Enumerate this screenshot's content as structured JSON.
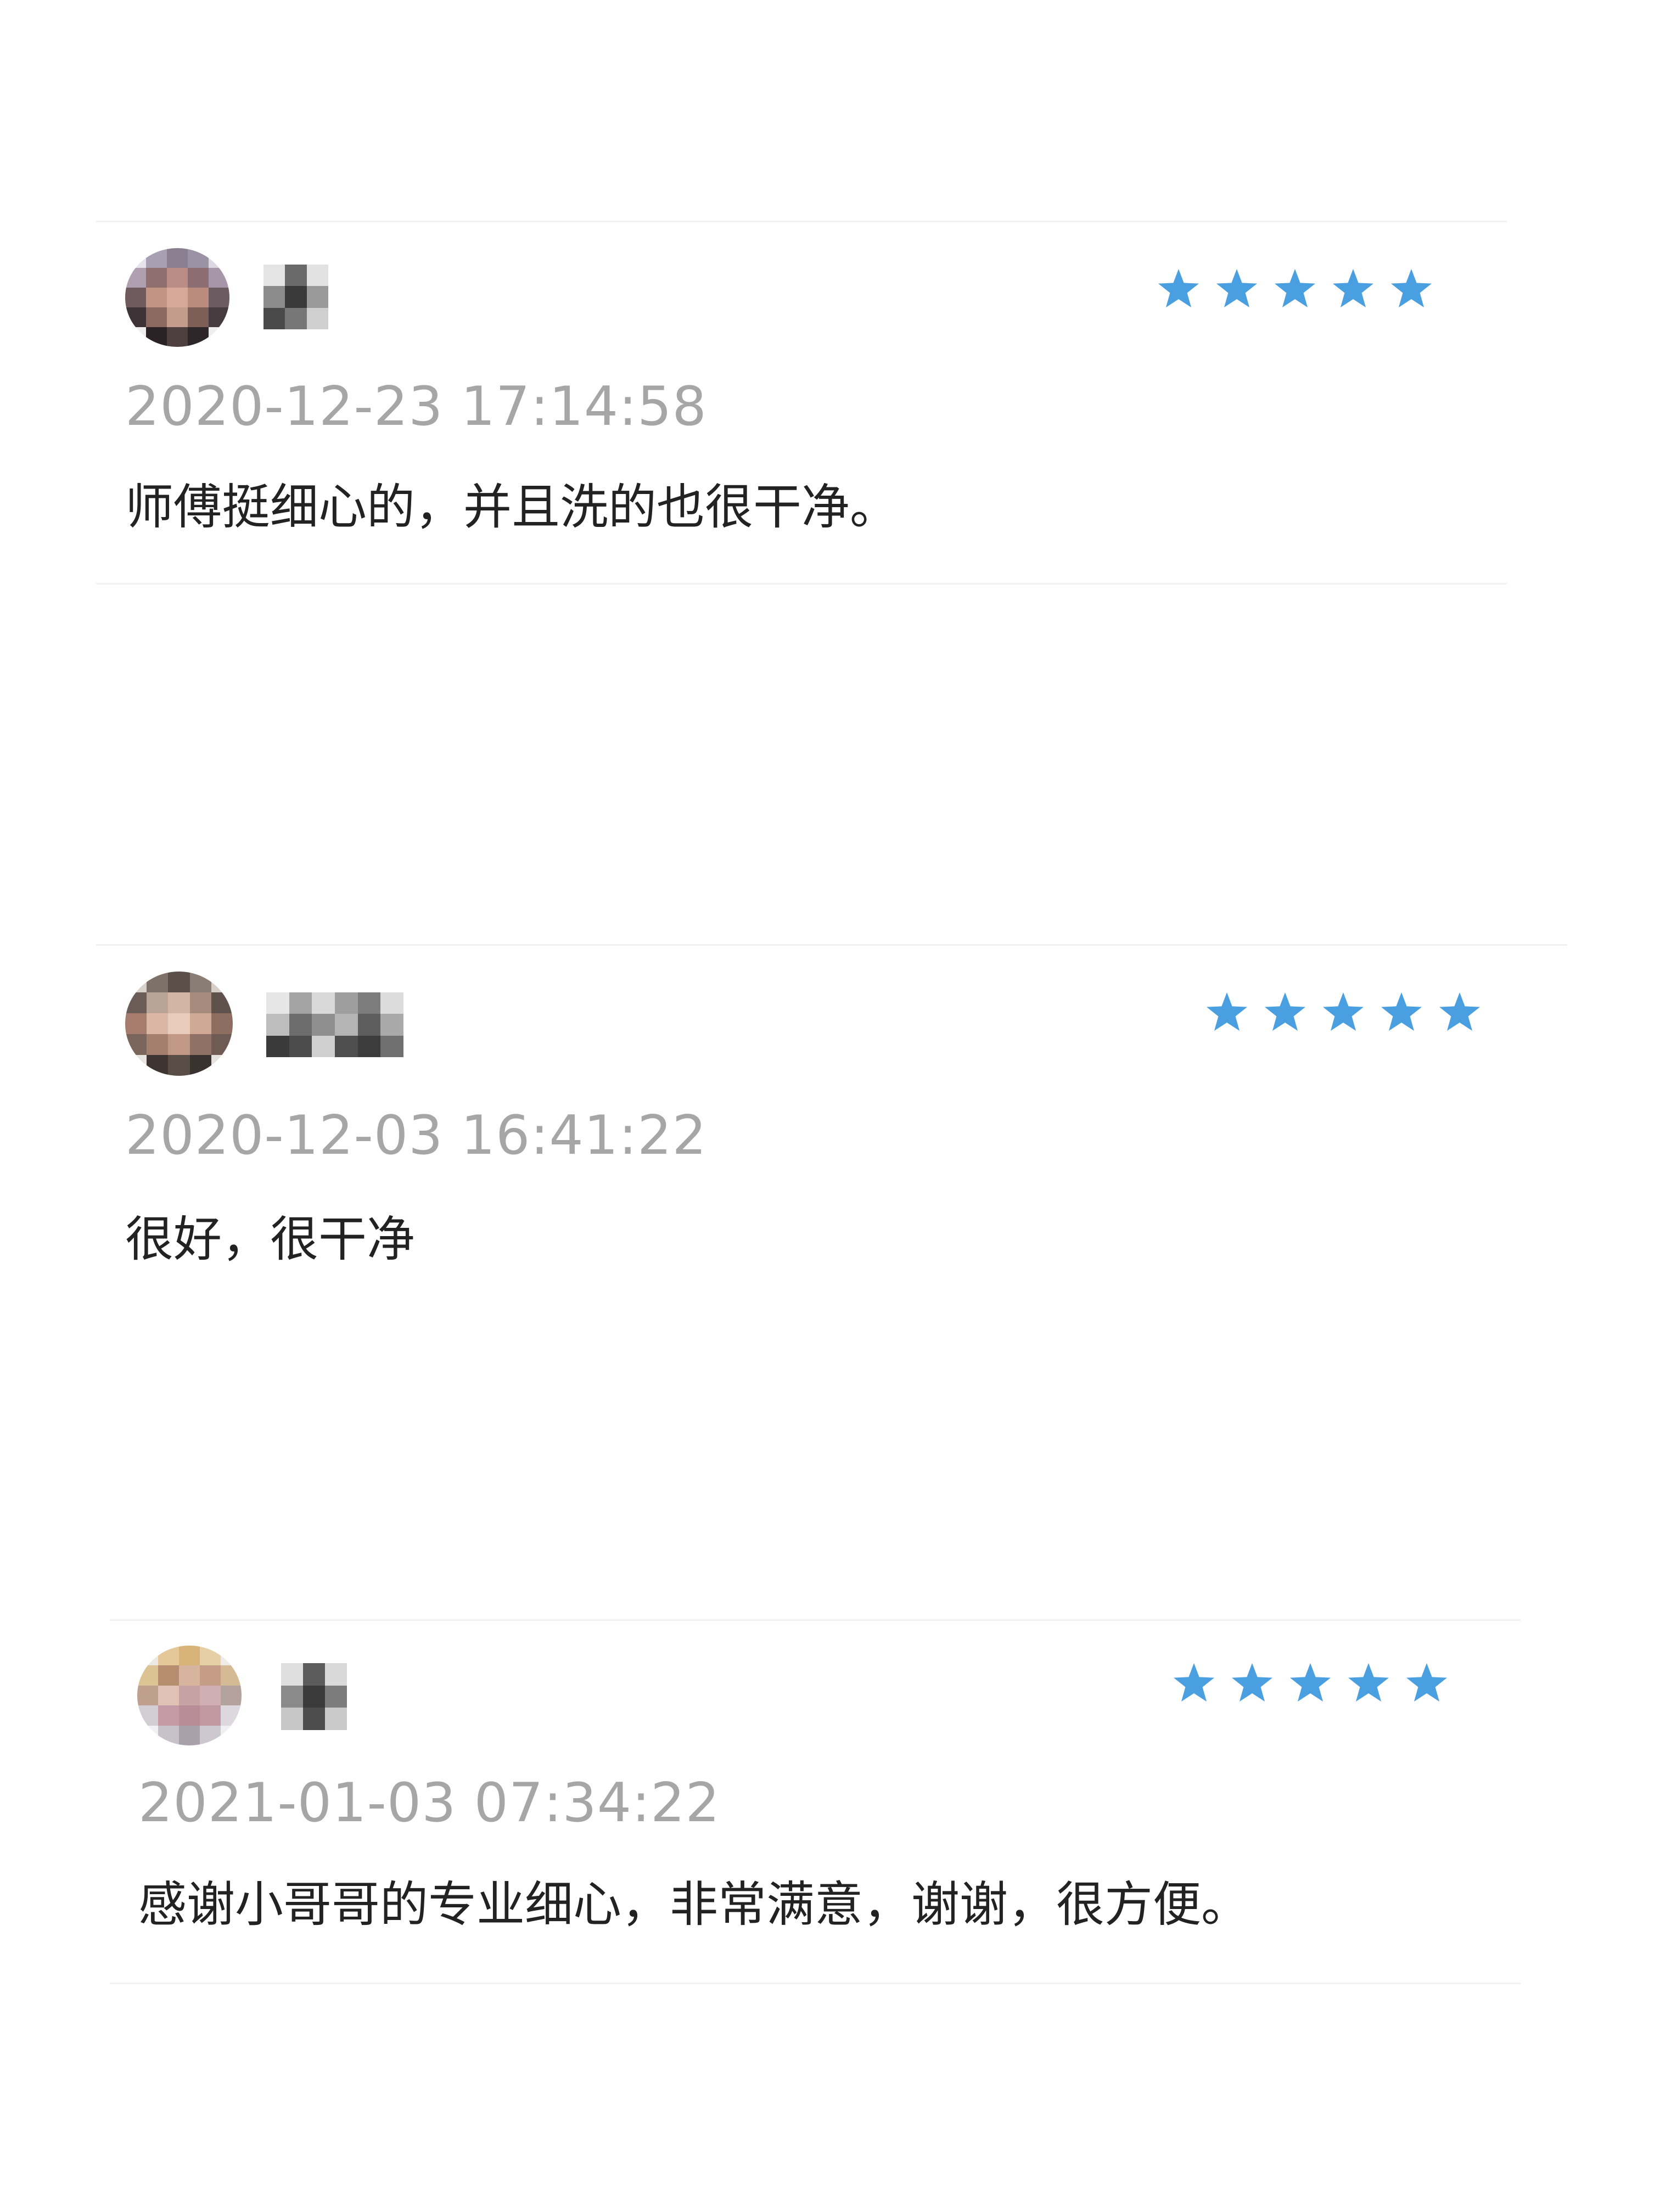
{
  "accent_color": "#4a9fe0",
  "star_icon": "star-icon",
  "reviews": [
    {
      "avatar_icon": "user-avatar",
      "name": "史",
      "rating": 5,
      "date": "2020-12-23 17:14:58",
      "comment": "师傅挺细心的，并且洗的也很干净。"
    },
    {
      "avatar_icon": "user-avatar",
      "name": "黑豆",
      "rating": 5,
      "date": "2020-12-03 16:41:22",
      "comment": "很好，很干净"
    },
    {
      "avatar_icon": "user-avatar",
      "name": "苗",
      "rating": 5,
      "date": "2021-01-03 07:34:22",
      "comment": "感谢小哥哥的专业细心，非常满意，谢谢，很方便。"
    }
  ]
}
